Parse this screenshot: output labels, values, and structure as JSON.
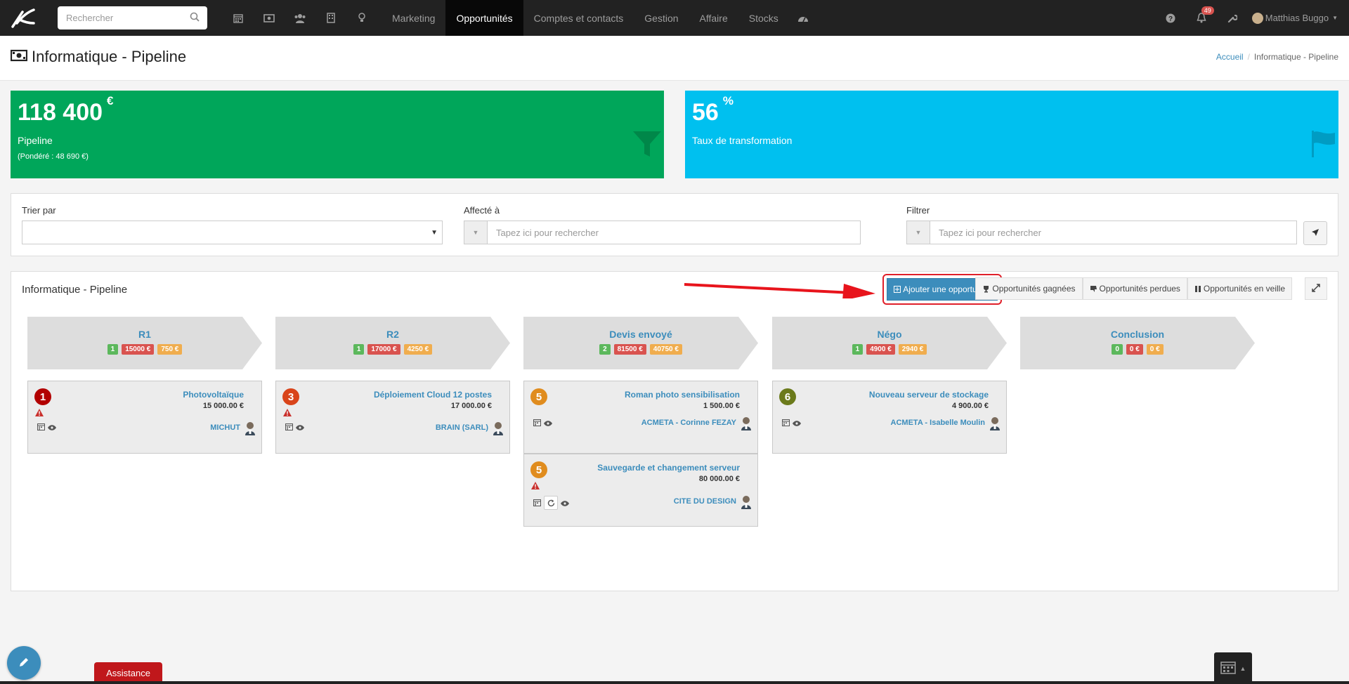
{
  "nav": {
    "search_placeholder": "Rechercher",
    "icons": [
      "calendar-icon",
      "money-icon",
      "users-icon",
      "building-icon",
      "lightbulb-icon"
    ],
    "links": [
      "Marketing",
      "Opportunités",
      "Comptes et contacts",
      "Gestion",
      "Affaire",
      "Stocks"
    ],
    "active_link": "Opportunités",
    "notification_count": "49",
    "user_name": "Matthias Buggo"
  },
  "header": {
    "title": "Informatique - Pipeline",
    "breadcrumb_home": "Accueil",
    "breadcrumb_current": "Informatique - Pipeline"
  },
  "stats": {
    "pipeline_value": "118 400",
    "pipeline_unit": "€",
    "pipeline_label": "Pipeline",
    "pipeline_weighted": "(Pondéré : 48 690 €)",
    "rate_value": "56",
    "rate_unit": "%",
    "rate_label": "Taux de transformation",
    "colors": {
      "green": "#00a65a",
      "cyan": "#00c0ef"
    }
  },
  "filters": {
    "sort_label": "Trier par",
    "assigned_label": "Affecté à",
    "assigned_placeholder": "Tapez ici pour rechercher",
    "filter_label": "Filtrer",
    "filter_placeholder": "Tapez ici pour rechercher"
  },
  "pipeline": {
    "title": "Informatique - Pipeline",
    "add_button": "Ajouter une opportunité",
    "won_button": "Opportunités gagnées",
    "lost_button": "Opportunités perdues",
    "standby_button": "Opportunités en veille",
    "stages": [
      {
        "name": "R1",
        "count": "1",
        "amount": "15000 €",
        "weighted": "750 €"
      },
      {
        "name": "R2",
        "count": "1",
        "amount": "17000 €",
        "weighted": "4250 €"
      },
      {
        "name": "Devis envoyé",
        "count": "2",
        "amount": "81500 €",
        "weighted": "40750 €"
      },
      {
        "name": "Négo",
        "count": "1",
        "amount": "4900 €",
        "weighted": "2940 €"
      },
      {
        "name": "Conclusion",
        "count": "0",
        "amount": "0 €",
        "weighted": "0 €"
      }
    ],
    "cards": [
      {
        "num": "1",
        "title": "Photovoltaïque",
        "amount": "15 000.00 €",
        "contact": "MICHUT"
      },
      {
        "num": "3",
        "title": "Déploiement Cloud 12 postes",
        "amount": "17 000.00 €",
        "contact": "BRAIN (SARL)"
      },
      {
        "num": "5",
        "title": "Roman photo sensibilisation",
        "amount": "1 500.00 €",
        "contact": "ACMETA - Corinne FEZAY"
      },
      {
        "num": "5",
        "title": "Sauvegarde et changement serveur",
        "amount": "80 000.00 €",
        "contact": "CITE DU DESIGN"
      },
      {
        "num": "6",
        "title": "Nouveau serveur de stockage",
        "amount": "4 900.00 €",
        "contact": "ACMETA - Isabelle Moulin"
      }
    ]
  },
  "footer": {
    "assistance_label": "Assistance"
  }
}
